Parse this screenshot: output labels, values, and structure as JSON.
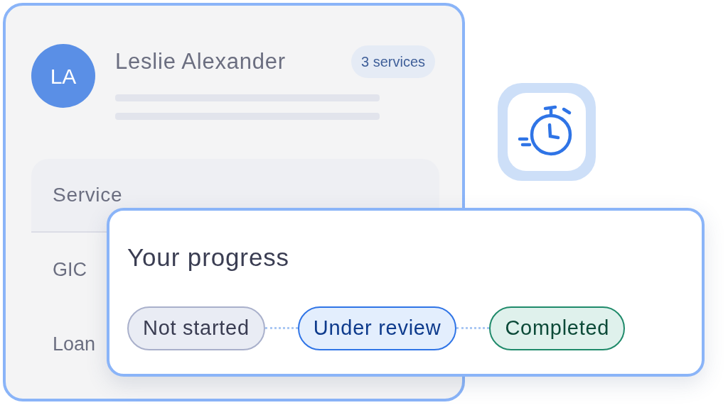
{
  "profile_card": {
    "avatar_initials": "LA",
    "name": "Leslie Alexander",
    "badge": "3 services",
    "table": {
      "columns": [
        "Service"
      ],
      "rows": [
        "GIC",
        "Loan"
      ]
    }
  },
  "progress_card": {
    "title": "Your progress",
    "steps": [
      {
        "label": "Not started",
        "kind": "not_started"
      },
      {
        "label": "Under review",
        "kind": "under_review"
      },
      {
        "label": "Completed",
        "kind": "completed"
      }
    ]
  }
}
